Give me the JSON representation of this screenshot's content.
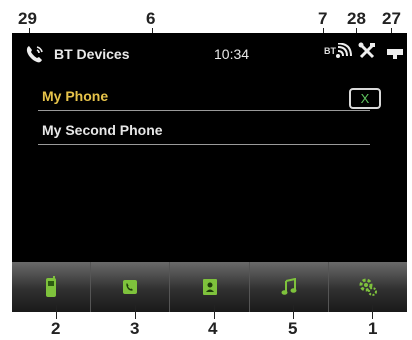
{
  "callouts": {
    "c29": "29",
    "c6": "6",
    "c7": "7",
    "c28": "28",
    "c27": "27",
    "c2": "2",
    "c3": "3",
    "c4": "4",
    "c5": "5",
    "c1": "1"
  },
  "status": {
    "title": "BT Devices",
    "time": "10:34",
    "bt_label": "BT",
    "icons": [
      "bluetooth-phone-icon",
      "bt-signal-icon",
      "tools-icon",
      "battery-icon"
    ]
  },
  "devices": [
    {
      "name": "My Phone",
      "selected": true
    },
    {
      "name": "My Second Phone",
      "selected": false
    }
  ],
  "disconnect_label": "X",
  "toolbar": {
    "items": [
      "phone-icon",
      "call-log-icon",
      "contacts-icon",
      "music-icon",
      "settings-icon"
    ]
  },
  "colors": {
    "selected_text": "#e6c34a",
    "accent_green": "#5ec25e",
    "screen_bg": "#000000"
  }
}
